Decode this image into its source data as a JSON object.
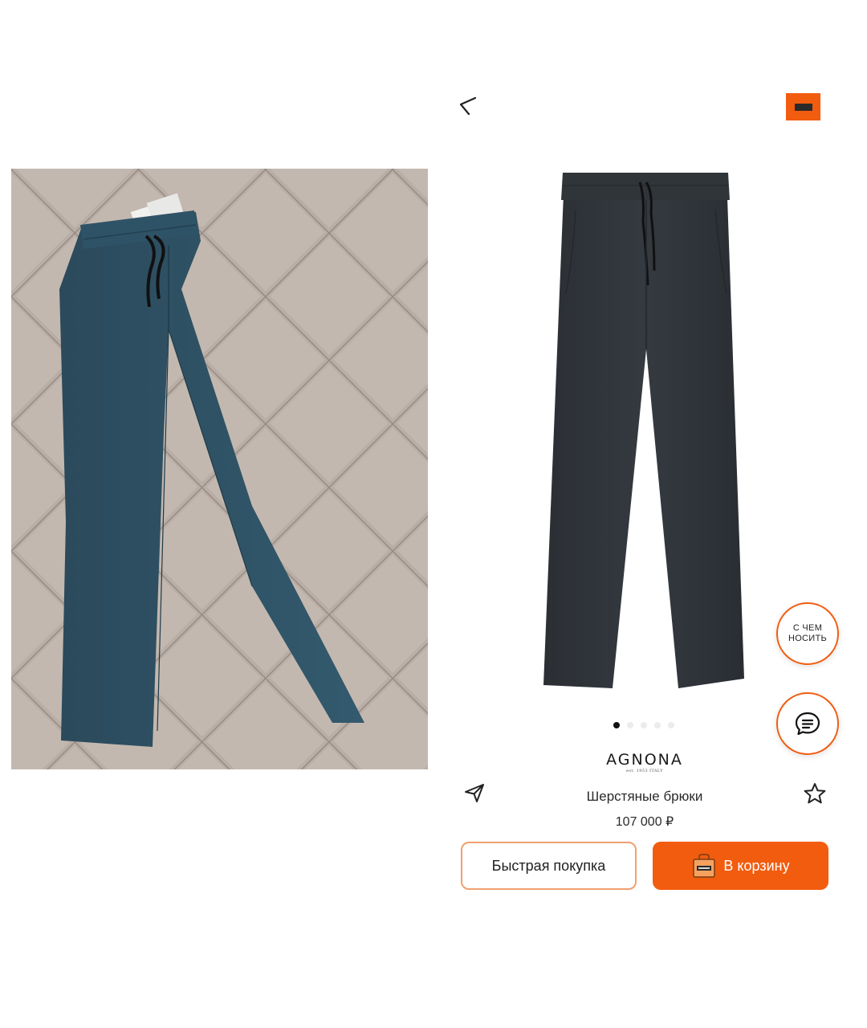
{
  "header": {
    "back_icon": "arrow-left-icon",
    "brand_badge": {
      "color": "#f25c0f",
      "icon": "brand-logo-icon"
    }
  },
  "left_photo": {
    "icon": "photo-of-trousers-on-quilted-blanket"
  },
  "product": {
    "image_icon": "trousers-product-image",
    "carousel": {
      "count": 5,
      "active": 1
    },
    "brand": {
      "name": "AGNONA",
      "tagline": "est. 1953 ITALY"
    },
    "name": "Шерстяные брюки",
    "price": "107 000 ₽"
  },
  "fab": {
    "outfit_label": "С ЧЕМ НОСИТЬ",
    "chat_icon": "chat-bubble-icon"
  },
  "actions": {
    "share_icon": "paper-plane-icon",
    "favorite_icon": "star-outline-icon",
    "quick_buy_label": "Быстрая покупка",
    "add_to_cart_label": "В корзину",
    "cart_icon": "shopping-bag-icon"
  },
  "colors": {
    "accent": "#f25c0f",
    "accent_border": "#f0a06e",
    "text": "#1a1a1a"
  }
}
